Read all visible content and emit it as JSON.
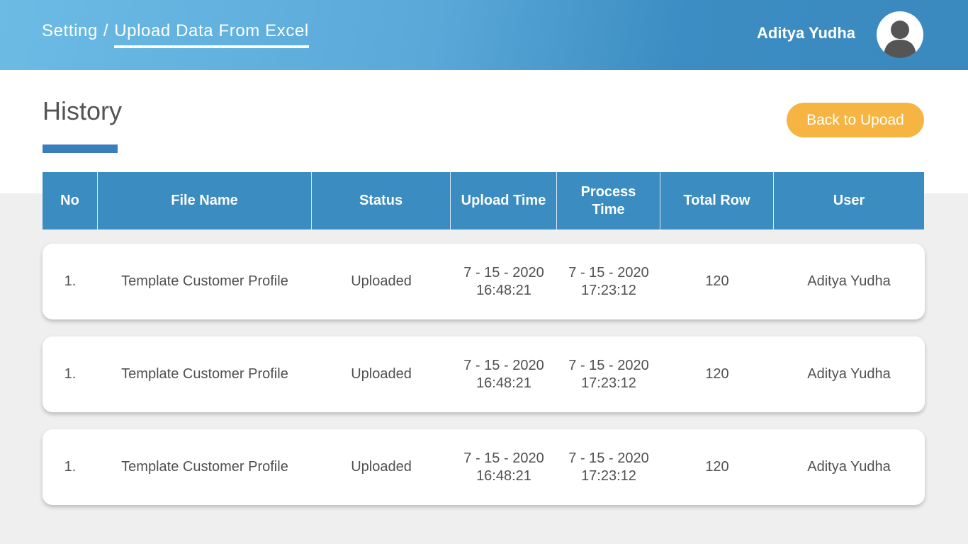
{
  "header": {
    "breadcrumb": {
      "parent": "Setting",
      "separator": "/",
      "current": "Upload Data From Excel"
    },
    "user_name": "Aditya Yudha",
    "avatar_icon": "user-avatar-icon"
  },
  "main": {
    "title": "History",
    "back_button_label": "Back to Upoad"
  },
  "table": {
    "columns": {
      "no": "No",
      "file_name": "File Name",
      "status": "Status",
      "upload_time_1": "Upload",
      "upload_time_2": "Time",
      "process_time_1": "Process",
      "process_time_2": "Time",
      "total_row": "Total Row",
      "user": "User"
    },
    "rows": [
      {
        "no": "1.",
        "file_name": "Template Customer Profile",
        "status": "Uploaded",
        "upload_date": "7 - 15 - 2020",
        "upload_time": "16:48:21",
        "process_date": "7 - 15 - 2020",
        "process_time": "17:23:12",
        "total_row": "120",
        "user": "Aditya Yudha"
      },
      {
        "no": "1.",
        "file_name": "Template Customer Profile",
        "status": "Uploaded",
        "upload_date": "7 - 15 - 2020",
        "upload_time": "16:48:21",
        "process_date": "7 - 15 - 2020",
        "process_time": "17:23:12",
        "total_row": "120",
        "user": "Aditya Yudha"
      },
      {
        "no": "1.",
        "file_name": "Template Customer Profile",
        "status": "Uploaded",
        "upload_date": "7 - 15 - 2020",
        "upload_time": "16:48:21",
        "process_date": "7 - 15 - 2020",
        "process_time": "17:23:12",
        "total_row": "120",
        "user": "Aditya Yudha"
      }
    ]
  },
  "colors": {
    "header_gradient_start": "#6cbbe5",
    "header_gradient_end": "#3a89bf",
    "table_header": "#3b8cc1",
    "accent_underline": "#3a7fbc",
    "button": "#f6b542",
    "background": "#efefef"
  }
}
